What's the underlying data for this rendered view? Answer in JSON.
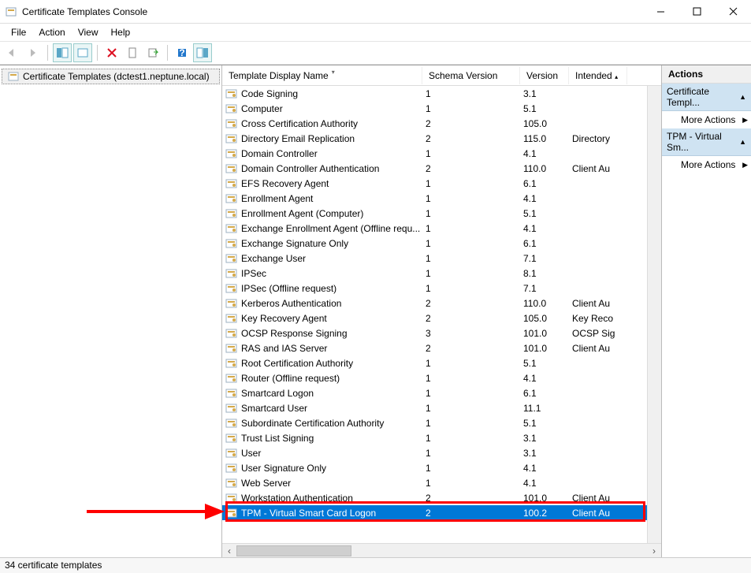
{
  "window": {
    "title": "Certificate Templates Console"
  },
  "menu": {
    "file": "File",
    "action": "Action",
    "view": "View",
    "help": "Help"
  },
  "tree": {
    "root": "Certificate Templates (dctest1.neptune.local)"
  },
  "columns": {
    "name": "Template Display Name",
    "schema": "Schema Version",
    "version": "Version",
    "intended": "Intended"
  },
  "rows": [
    {
      "name": "Code Signing",
      "schema": "1",
      "ver": "3.1",
      "intended": ""
    },
    {
      "name": "Computer",
      "schema": "1",
      "ver": "5.1",
      "intended": ""
    },
    {
      "name": "Cross Certification Authority",
      "schema": "2",
      "ver": "105.0",
      "intended": ""
    },
    {
      "name": "Directory Email Replication",
      "schema": "2",
      "ver": "115.0",
      "intended": "Directory"
    },
    {
      "name": "Domain Controller",
      "schema": "1",
      "ver": "4.1",
      "intended": ""
    },
    {
      "name": "Domain Controller Authentication",
      "schema": "2",
      "ver": "110.0",
      "intended": "Client Au"
    },
    {
      "name": "EFS Recovery Agent",
      "schema": "1",
      "ver": "6.1",
      "intended": ""
    },
    {
      "name": "Enrollment Agent",
      "schema": "1",
      "ver": "4.1",
      "intended": ""
    },
    {
      "name": "Enrollment Agent (Computer)",
      "schema": "1",
      "ver": "5.1",
      "intended": ""
    },
    {
      "name": "Exchange Enrollment Agent (Offline requ...",
      "schema": "1",
      "ver": "4.1",
      "intended": ""
    },
    {
      "name": "Exchange Signature Only",
      "schema": "1",
      "ver": "6.1",
      "intended": ""
    },
    {
      "name": "Exchange User",
      "schema": "1",
      "ver": "7.1",
      "intended": ""
    },
    {
      "name": "IPSec",
      "schema": "1",
      "ver": "8.1",
      "intended": ""
    },
    {
      "name": "IPSec (Offline request)",
      "schema": "1",
      "ver": "7.1",
      "intended": ""
    },
    {
      "name": "Kerberos Authentication",
      "schema": "2",
      "ver": "110.0",
      "intended": "Client Au"
    },
    {
      "name": "Key Recovery Agent",
      "schema": "2",
      "ver": "105.0",
      "intended": "Key Reco"
    },
    {
      "name": "OCSP Response Signing",
      "schema": "3",
      "ver": "101.0",
      "intended": "OCSP Sig"
    },
    {
      "name": "RAS and IAS Server",
      "schema": "2",
      "ver": "101.0",
      "intended": "Client Au"
    },
    {
      "name": "Root Certification Authority",
      "schema": "1",
      "ver": "5.1",
      "intended": ""
    },
    {
      "name": "Router (Offline request)",
      "schema": "1",
      "ver": "4.1",
      "intended": ""
    },
    {
      "name": "Smartcard Logon",
      "schema": "1",
      "ver": "6.1",
      "intended": ""
    },
    {
      "name": "Smartcard User",
      "schema": "1",
      "ver": "11.1",
      "intended": ""
    },
    {
      "name": "Subordinate Certification Authority",
      "schema": "1",
      "ver": "5.1",
      "intended": ""
    },
    {
      "name": "Trust List Signing",
      "schema": "1",
      "ver": "3.1",
      "intended": ""
    },
    {
      "name": "User",
      "schema": "1",
      "ver": "3.1",
      "intended": ""
    },
    {
      "name": "User Signature Only",
      "schema": "1",
      "ver": "4.1",
      "intended": ""
    },
    {
      "name": "Web Server",
      "schema": "1",
      "ver": "4.1",
      "intended": ""
    },
    {
      "name": "Workstation Authentication",
      "schema": "2",
      "ver": "101.0",
      "intended": "Client Au"
    },
    {
      "name": "TPM - Virtual Smart Card Logon",
      "schema": "2",
      "ver": "100.2",
      "intended": "Client Au",
      "selected": true
    }
  ],
  "actions": {
    "header": "Actions",
    "group1": "Certificate Templ...",
    "more1": "More Actions",
    "group2": "TPM - Virtual Sm...",
    "more2": "More Actions"
  },
  "status": "34 certificate templates"
}
